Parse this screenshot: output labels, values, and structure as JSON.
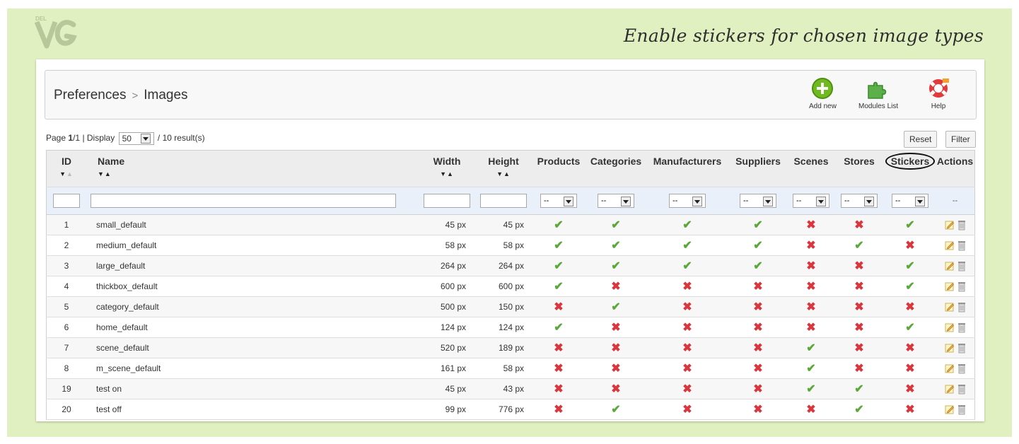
{
  "headline": "Enable stickers for chosen image types",
  "breadcrumb": {
    "section": "Preferences",
    "separator": ">",
    "page": "Images"
  },
  "toolbar": {
    "add_new": "Add new",
    "modules_list": "Modules List",
    "help": "Help"
  },
  "pagination": {
    "prefix": "Page",
    "current": "1",
    "slash": "/",
    "total": "1",
    "display_label": "| Display",
    "per_page": "50",
    "results": "/ 10 result(s)"
  },
  "buttons": {
    "reset": "Reset",
    "filter": "Filter"
  },
  "columns": {
    "id": "ID",
    "name": "Name",
    "width": "Width",
    "height": "Height",
    "products": "Products",
    "categories": "Categories",
    "manufacturers": "Manufacturers",
    "suppliers": "Suppliers",
    "scenes": "Scenes",
    "stores": "Stores",
    "stickers": "Stickers",
    "actions": "Actions"
  },
  "filter": {
    "select_value": "--",
    "actions_placeholder": "--"
  },
  "rows": [
    {
      "id": "1",
      "name": "small_default",
      "width": "45 px",
      "height": "45 px",
      "flags": [
        true,
        true,
        true,
        true,
        false,
        false,
        true
      ]
    },
    {
      "id": "2",
      "name": "medium_default",
      "width": "58 px",
      "height": "58 px",
      "flags": [
        true,
        true,
        true,
        true,
        false,
        true,
        false
      ]
    },
    {
      "id": "3",
      "name": "large_default",
      "width": "264 px",
      "height": "264 px",
      "flags": [
        true,
        true,
        true,
        true,
        false,
        false,
        true
      ]
    },
    {
      "id": "4",
      "name": "thickbox_default",
      "width": "600 px",
      "height": "600 px",
      "flags": [
        true,
        false,
        false,
        false,
        false,
        false,
        true
      ]
    },
    {
      "id": "5",
      "name": "category_default",
      "width": "500 px",
      "height": "150 px",
      "flags": [
        false,
        true,
        false,
        false,
        false,
        false,
        false
      ]
    },
    {
      "id": "6",
      "name": "home_default",
      "width": "124 px",
      "height": "124 px",
      "flags": [
        true,
        false,
        false,
        false,
        false,
        false,
        true
      ]
    },
    {
      "id": "7",
      "name": "scene_default",
      "width": "520 px",
      "height": "189 px",
      "flags": [
        false,
        false,
        false,
        false,
        true,
        false,
        false
      ]
    },
    {
      "id": "8",
      "name": "m_scene_default",
      "width": "161 px",
      "height": "58 px",
      "flags": [
        false,
        false,
        false,
        false,
        true,
        false,
        false
      ]
    },
    {
      "id": "19",
      "name": "test on",
      "width": "45 px",
      "height": "43 px",
      "flags": [
        false,
        false,
        false,
        false,
        true,
        true,
        false
      ]
    },
    {
      "id": "20",
      "name": "test off",
      "width": "99 px",
      "height": "776 px",
      "flags": [
        false,
        true,
        false,
        false,
        false,
        true,
        false
      ]
    }
  ],
  "icons": {
    "yes": "check-icon",
    "no": "cross-icon",
    "edit": "pencil-icon",
    "delete": "trash-icon"
  },
  "colors": {
    "background": "#e1f0c1",
    "check": "#5aa83a",
    "cross": "#d9363e"
  }
}
